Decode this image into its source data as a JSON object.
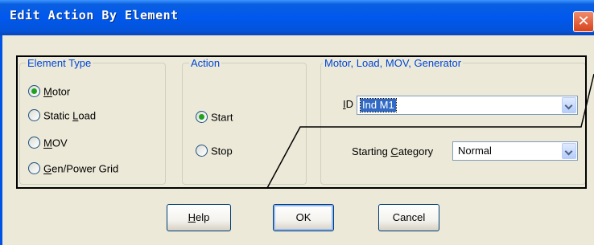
{
  "window": {
    "title": "Edit Action By Element",
    "close_symbol": "✕"
  },
  "element_type": {
    "legend": "Element Type",
    "options": [
      {
        "pre": "",
        "key": "M",
        "post": "otor",
        "checked": true
      },
      {
        "pre": "Static ",
        "key": "L",
        "post": "oad",
        "checked": false
      },
      {
        "pre": "",
        "key": "M",
        "post": "OV",
        "checked": false
      },
      {
        "pre": "",
        "key": "G",
        "post": "en/Power Grid",
        "checked": false
      }
    ]
  },
  "action": {
    "legend": "Action",
    "options": [
      {
        "label": "Start",
        "checked": true
      },
      {
        "label": "Stop",
        "checked": false
      }
    ]
  },
  "motor_group": {
    "legend": "Motor, Load, MOV, Generator",
    "id_label_key": "I",
    "id_label_rest": "D",
    "id_value": "Ind M1",
    "starting_category_label_pre": "Starting ",
    "starting_category_label_key": "C",
    "starting_category_label_post": "ategory",
    "starting_category_value": "Normal"
  },
  "buttons": {
    "help_key": "H",
    "help_rest": "elp",
    "ok": "OK",
    "cancel": "Cancel"
  },
  "colors": {
    "title_bar": "#0058ee",
    "face": "#ece9d8",
    "legend_text": "#0046d5",
    "selection": "#316ac5",
    "close_button": "#d6431c"
  }
}
